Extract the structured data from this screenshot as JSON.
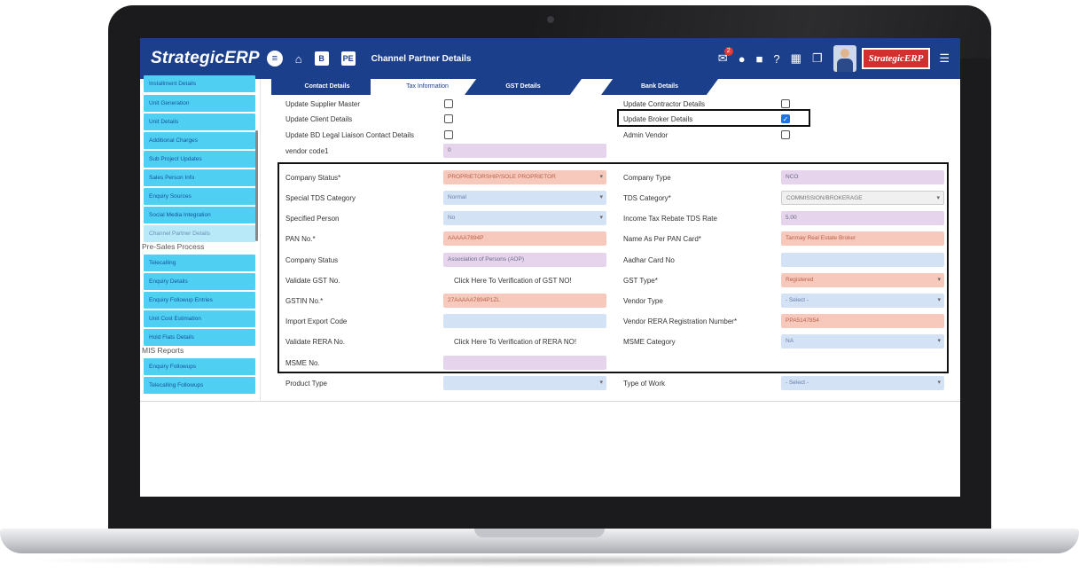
{
  "header": {
    "logo": "StrategicERP",
    "page_title": "Channel Partner Details",
    "pe_badge": "PE",
    "b_badge": "B",
    "notification_count": "2",
    "brand_badge": "StrategicERP"
  },
  "sidebar": {
    "items_top": [
      "Installment Details",
      "Unit Generation",
      "Unit Details",
      "Additional Charges",
      "Sub Project Updates",
      "Sales Person Info",
      "Enquiry Sources",
      "Social Media Integration",
      "Channel Partner Details"
    ],
    "section_presales": "Pre-Sales Process",
    "items_presales": [
      "Telecalling",
      "Enquiry Details",
      "Enquiry Followup Entries",
      "Unit Cost Estimation",
      "Hold Flats Details"
    ],
    "section_mis": "MIS Reports",
    "items_mis": [
      "Enquiry Followups",
      "Telecalling Followups"
    ]
  },
  "tabs": [
    "Contact Details",
    "Tax Information",
    "GST Details",
    "Bank Details"
  ],
  "form": {
    "update_supplier_master": "Update Supplier Master",
    "update_client_details": "Update Client Details",
    "update_bd_legal": "Update BD Legal Liaison Contact Details",
    "vendor_code1": "vendor code1",
    "vendor_code1_value": "0",
    "update_contractor_details": "Update Contractor Details",
    "update_broker_details": "Update Broker Details",
    "admin_vendor": "Admin Vendor",
    "company_status_req": "Company Status*",
    "company_status_req_value": "PROPRIETORSHIP/SOLE PROPRIETOR",
    "company_type": "Company Type",
    "company_type_value": "NCO",
    "special_tds_category": "Special TDS Category",
    "special_tds_category_value": "Normal",
    "tds_category": "TDS Category*",
    "tds_category_value": "COMMISSION/BROKERAGE",
    "specified_person": "Specified Person",
    "specified_person_value": "No",
    "income_tax_rebate": "Income Tax Rebate TDS Rate",
    "income_tax_rebate_value": "5.00",
    "pan_no": "PAN No.*",
    "pan_no_value": "AAAAA7894P",
    "name_as_per_pan": "Name As Per PAN Card*",
    "name_as_per_pan_value": "Tanmay Real Estate Broker",
    "company_status": "Company Status",
    "company_status_value": "Association of Persons (AOP)",
    "aadhar_card_no": "Aadhar Card No",
    "validate_gst_no": "Validate GST No.",
    "validate_gst_link": "Click Here To Verification of GST NO!",
    "gst_type": "GST Type*",
    "gst_type_value": "Registered",
    "gstin_no": "GSTIN No.*",
    "gstin_no_value": "27AAAAA7894P1ZL",
    "vendor_type": "Vendor Type",
    "vendor_type_value": "- Select -",
    "import_export_code": "Import Export Code",
    "vendor_rera_no": "Vendor RERA Registration Number*",
    "vendor_rera_no_value": "PPA5147854",
    "validate_rera_no": "Validate RERA No.",
    "validate_rera_link": "Click Here To Verification of RERA NO!",
    "msme_category": "MSME Category",
    "msme_category_value": "NA",
    "msme_no": "MSME No.",
    "product_type": "Product Type",
    "type_of_work": "Type of Work",
    "type_of_work_value": "- Select -"
  },
  "colors": {
    "header": "#1c3f8c",
    "sidebar_item": "#4fd0f3",
    "field_pink": "#f7c9bc",
    "field_lavender": "#e5d4ec",
    "field_blue": "#d4e2f6",
    "checkbox_checked": "#1e73e8",
    "brand_red": "#d32f2f"
  }
}
